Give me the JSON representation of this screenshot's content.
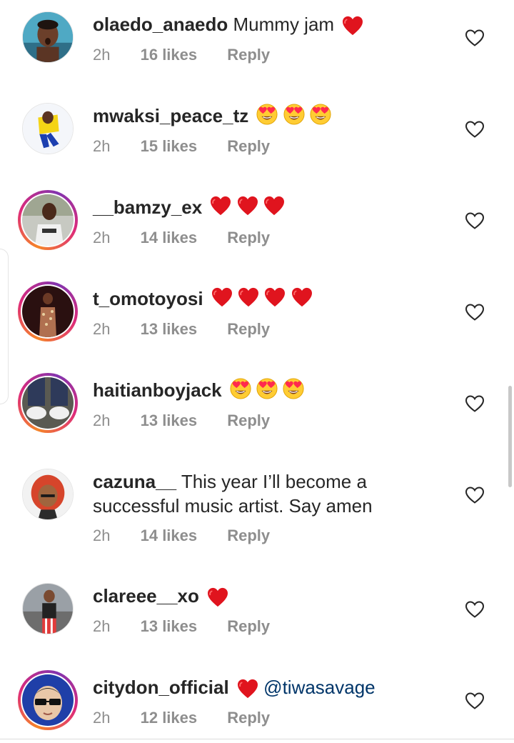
{
  "icons": {
    "like": "heart-outline-icon",
    "heart_emoji": "red-heart-emoji",
    "heart_eyes_emoji": "heart-eyes-emoji"
  },
  "colors": {
    "username": "#262626",
    "meta": "#8e8e8e",
    "mention": "#003569",
    "heart": "#ed1c24",
    "story_ring_start": "#f58529",
    "story_ring_end": "#dd2a7b"
  },
  "comments": [
    {
      "username": "olaedo_anaedo",
      "text": "Mummy jam",
      "emojis": "",
      "time": "2h",
      "likes": "16 likes",
      "reply": "Reply"
    },
    {
      "username": "mwaksi_peace_tz",
      "text": "",
      "emojis": "",
      "time": "2h",
      "likes": "15 likes",
      "reply": "Reply"
    },
    {
      "username": "__bamzy_ex",
      "text": "",
      "emojis": "",
      "time": "2h",
      "likes": "14 likes",
      "reply": "Reply"
    },
    {
      "username": "t_omotoyosi",
      "text": "",
      "emojis": "",
      "time": "2h",
      "likes": "13 likes",
      "reply": "Reply"
    },
    {
      "username": "haitianboyjack",
      "text": "",
      "emojis": "",
      "time": "2h",
      "likes": "13 likes",
      "reply": "Reply"
    },
    {
      "username": "cazuna__",
      "text": "This year I’ll become a",
      "text2": "successful music artist. Say amen",
      "time": "2h",
      "likes": "14 likes",
      "reply": "Reply"
    },
    {
      "username": "clareee__xo",
      "text": "",
      "time": "2h",
      "likes": "13 likes",
      "reply": "Reply"
    },
    {
      "username": "citydon_official",
      "text": "",
      "mention": "@tiwasavage",
      "time": "2h",
      "likes": "12 likes",
      "reply": "Reply"
    }
  ]
}
